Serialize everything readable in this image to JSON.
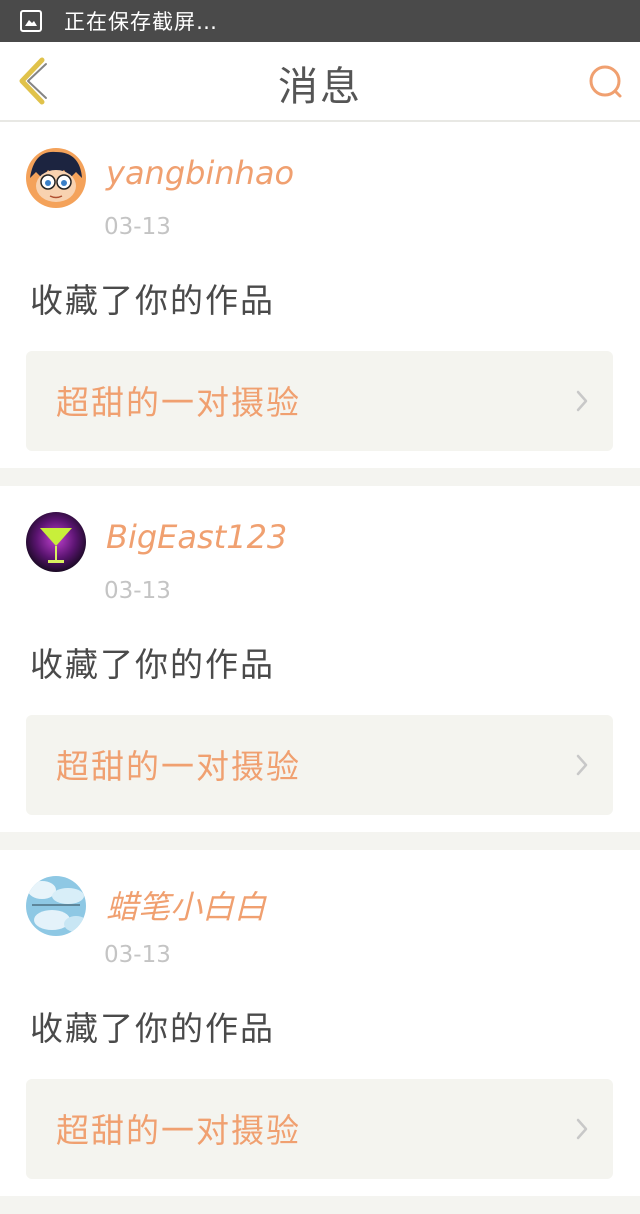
{
  "status_bar": {
    "icon": "image-icon",
    "text": "正在保存截屏…"
  },
  "header": {
    "title": "消息",
    "back_icon": "chevron-left-icon",
    "search_icon": "search-icon"
  },
  "colors": {
    "accent": "#f0a070",
    "back_icon": "#e0c24a",
    "search_icon": "#f0a070",
    "status_bar_bg": "#4a4a4a"
  },
  "messages": [
    {
      "username": "yangbinhao",
      "date": "03-13",
      "action": "收藏了你的作品",
      "work_title": "超甜的一对摄验"
    },
    {
      "username": "BigEast123",
      "date": "03-13",
      "action": "收藏了你的作品",
      "work_title": "超甜的一对摄验"
    },
    {
      "username": "蜡笔小白白",
      "date": "03-13",
      "action": "收藏了你的作品",
      "work_title": "超甜的一对摄验"
    }
  ]
}
